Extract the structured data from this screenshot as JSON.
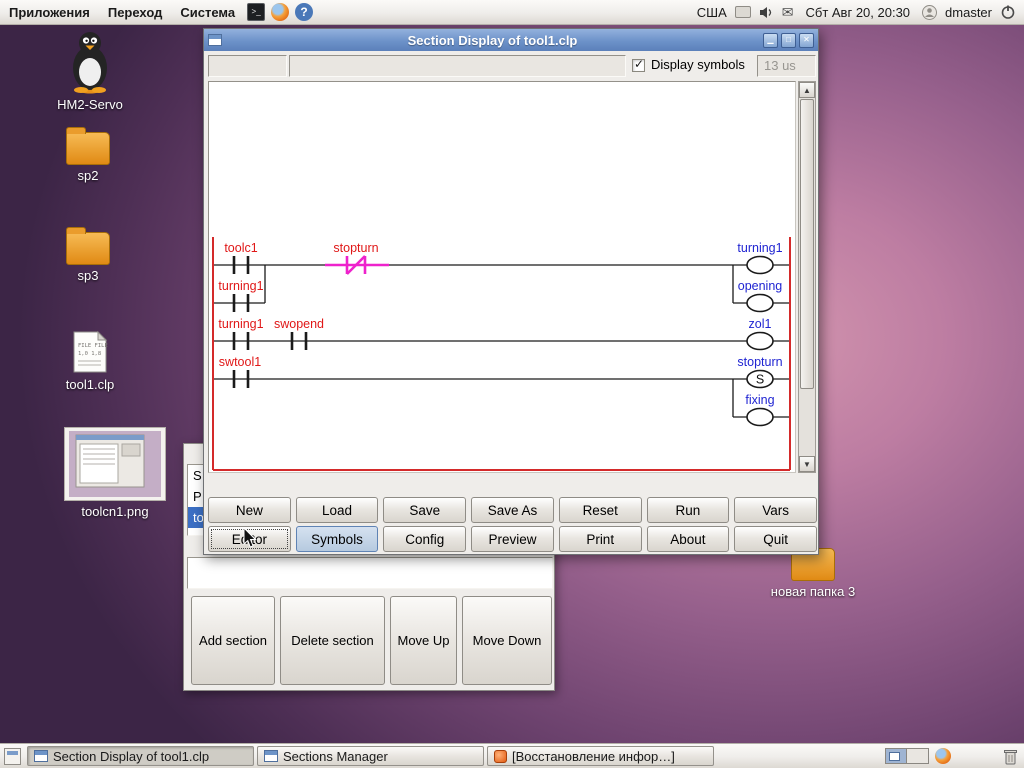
{
  "panel": {
    "menu_applications": "Приложения",
    "menu_places": "Переход",
    "menu_system": "Система",
    "keyboard_layout": "США",
    "clock": "Сбт Авг 20, 20:30",
    "username": "dmaster"
  },
  "desktop_icons": [
    {
      "label": "HM2-Servo"
    },
    {
      "label": "sp2"
    },
    {
      "label": "sp3"
    },
    {
      "label": "tool1.clp"
    },
    {
      "label": "toolcn1.png"
    },
    {
      "label": "новая папка 3"
    }
  ],
  "file_icon_lines": [
    "FILE FILE",
    "1,0 1,8"
  ],
  "main_window": {
    "title": "Section Display of tool1.clp",
    "display_symbols_label": "Display symbols",
    "scan_time": "13 us",
    "buttons_row1": [
      "New",
      "Load",
      "Save",
      "Save As",
      "Reset",
      "Run",
      "Vars"
    ],
    "buttons_row2": [
      "Editor",
      "Symbols",
      "Config",
      "Preview",
      "Print",
      "About",
      "Quit"
    ],
    "ladder": {
      "r1_c1": "toolc1",
      "r1_c2": "stopturn",
      "r1_coil": "turning1",
      "r2_c1": "turning1",
      "r2_coil": "opening",
      "r3_c1": "turning1",
      "r3_c2": "swopend",
      "r3_coil": "zol1",
      "r4_c1": "swtool1",
      "r4_coil": "stopturn",
      "r4_coil_char": "S",
      "r5_coil": "fixing"
    }
  },
  "sections_manager": {
    "items": [
      "S",
      "P",
      "to"
    ],
    "buttons": [
      "Add section",
      "Delete section",
      "Move Up",
      "Move Down"
    ]
  },
  "taskbar": {
    "tasks": [
      {
        "label": "Section Display of tool1.clp"
      },
      {
        "label": "Sections Manager"
      },
      {
        "label": "[Восстановление инфор…]"
      }
    ]
  },
  "colors": {
    "titlebar": "#6d92c9",
    "rail_red": "#d42a2a",
    "contact_label_red": "#e01818",
    "coil_label_blue": "#2025d2",
    "highlight_magenta": "#ee22cc",
    "selection_blue": "#3b6fc4"
  }
}
